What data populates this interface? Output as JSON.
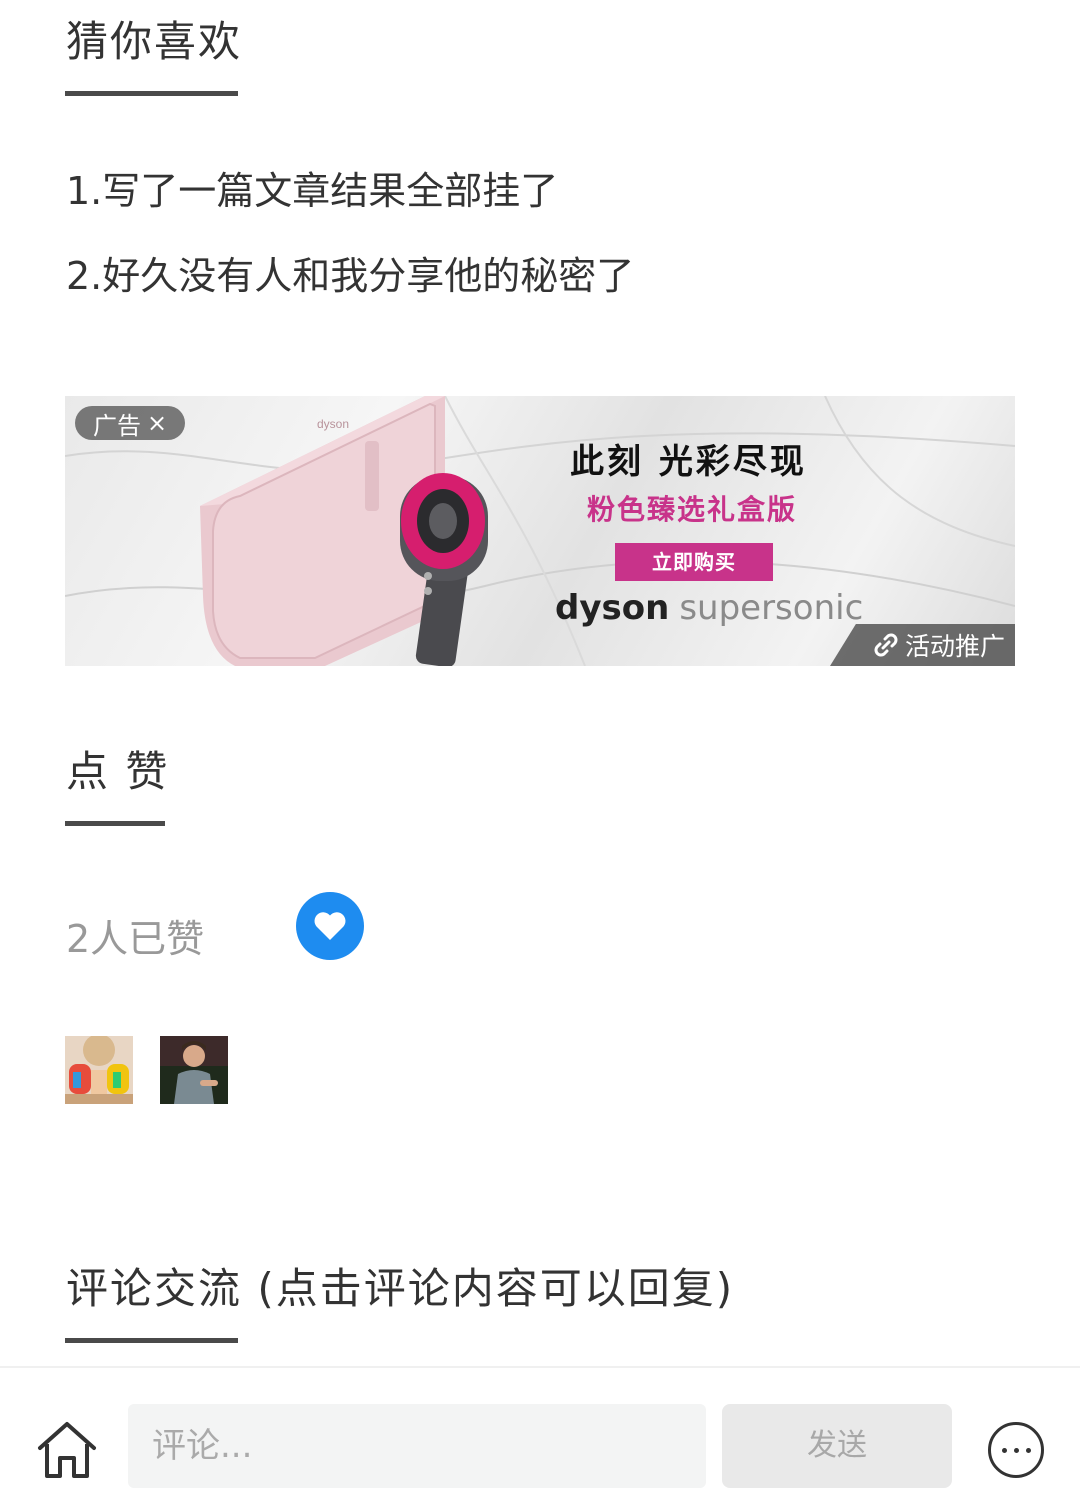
{
  "recommend": {
    "title": "猜你喜欢",
    "items": [
      "1.写了一篇文章结果全部挂了",
      "2.好久没有人和我分享他的秘密了"
    ]
  },
  "ad": {
    "badge_label": "广告",
    "close_glyph": "×",
    "headline": "此刻 光彩尽现",
    "subheadline": "粉色臻选礼盒版",
    "buy_label": "立即购买",
    "brand_bold": "dyson",
    "brand_light": "supersonic",
    "case_logo": "dyson",
    "promo_label": "活动推广",
    "accent_color": "#c8338a"
  },
  "likes": {
    "title": "点 赞",
    "count_text": "2人已赞",
    "button_icon": "heart-icon",
    "button_color": "#1e8cf0",
    "avatars": [
      "avatar-painted-hands",
      "avatar-man-portrait"
    ]
  },
  "comments": {
    "title": "评论交流 (点击评论内容可以回复)"
  },
  "bottom_bar": {
    "home_icon": "home-icon",
    "comment_placeholder": "评论...",
    "send_label": "发送",
    "more_icon": "more-icon"
  }
}
